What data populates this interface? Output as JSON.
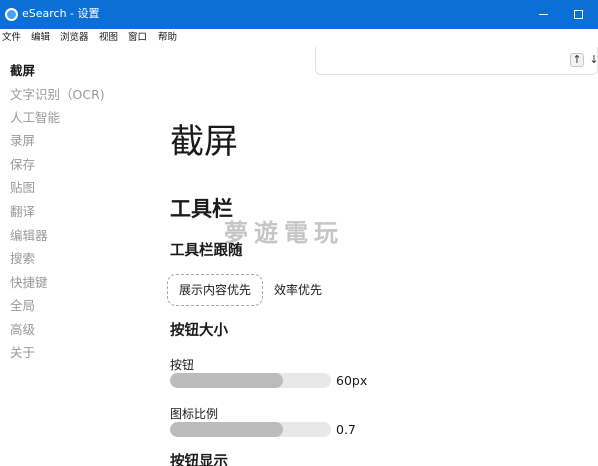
{
  "window": {
    "title": "eSearch - 设置",
    "titlebar_color": "#0b6fd6"
  },
  "menubar": {
    "items": [
      "文件",
      "编辑",
      "浏览器",
      "视图",
      "窗口",
      "帮助"
    ]
  },
  "search": {
    "up_icon": "arrow-up-icon",
    "down_icon": "arrow-down-icon",
    "up_glyph": "↑",
    "down_glyph": "↓"
  },
  "sidebar": {
    "items": [
      {
        "label": "截屏",
        "active": true
      },
      {
        "label": "文字识别（OCR)",
        "active": false
      },
      {
        "label": "人工智能",
        "active": false
      },
      {
        "label": "录屏",
        "active": false
      },
      {
        "label": "保存",
        "active": false
      },
      {
        "label": "贴图",
        "active": false
      },
      {
        "label": "翻译",
        "active": false
      },
      {
        "label": "编辑器",
        "active": false
      },
      {
        "label": "搜索",
        "active": false
      },
      {
        "label": "快捷键",
        "active": false
      },
      {
        "label": "全局",
        "active": false
      },
      {
        "label": "高级",
        "active": false
      },
      {
        "label": "关于",
        "active": false
      }
    ]
  },
  "main": {
    "page_title": "截屏",
    "section_title": "工具栏",
    "follow": {
      "title": "工具栏跟随",
      "options": [
        "展示内容优先",
        "效率优先"
      ],
      "selected": "展示内容优先"
    },
    "button_size": {
      "title": "按钮大小",
      "button": {
        "label": "按钮",
        "value_text": "60px",
        "fraction": 0.7
      },
      "icon_scale": {
        "label": "图标比例",
        "value_text": "0.7",
        "fraction": 0.7
      }
    },
    "button_display": {
      "title": "按钮显示"
    }
  },
  "watermark": {
    "text": "夢遊電玩"
  }
}
